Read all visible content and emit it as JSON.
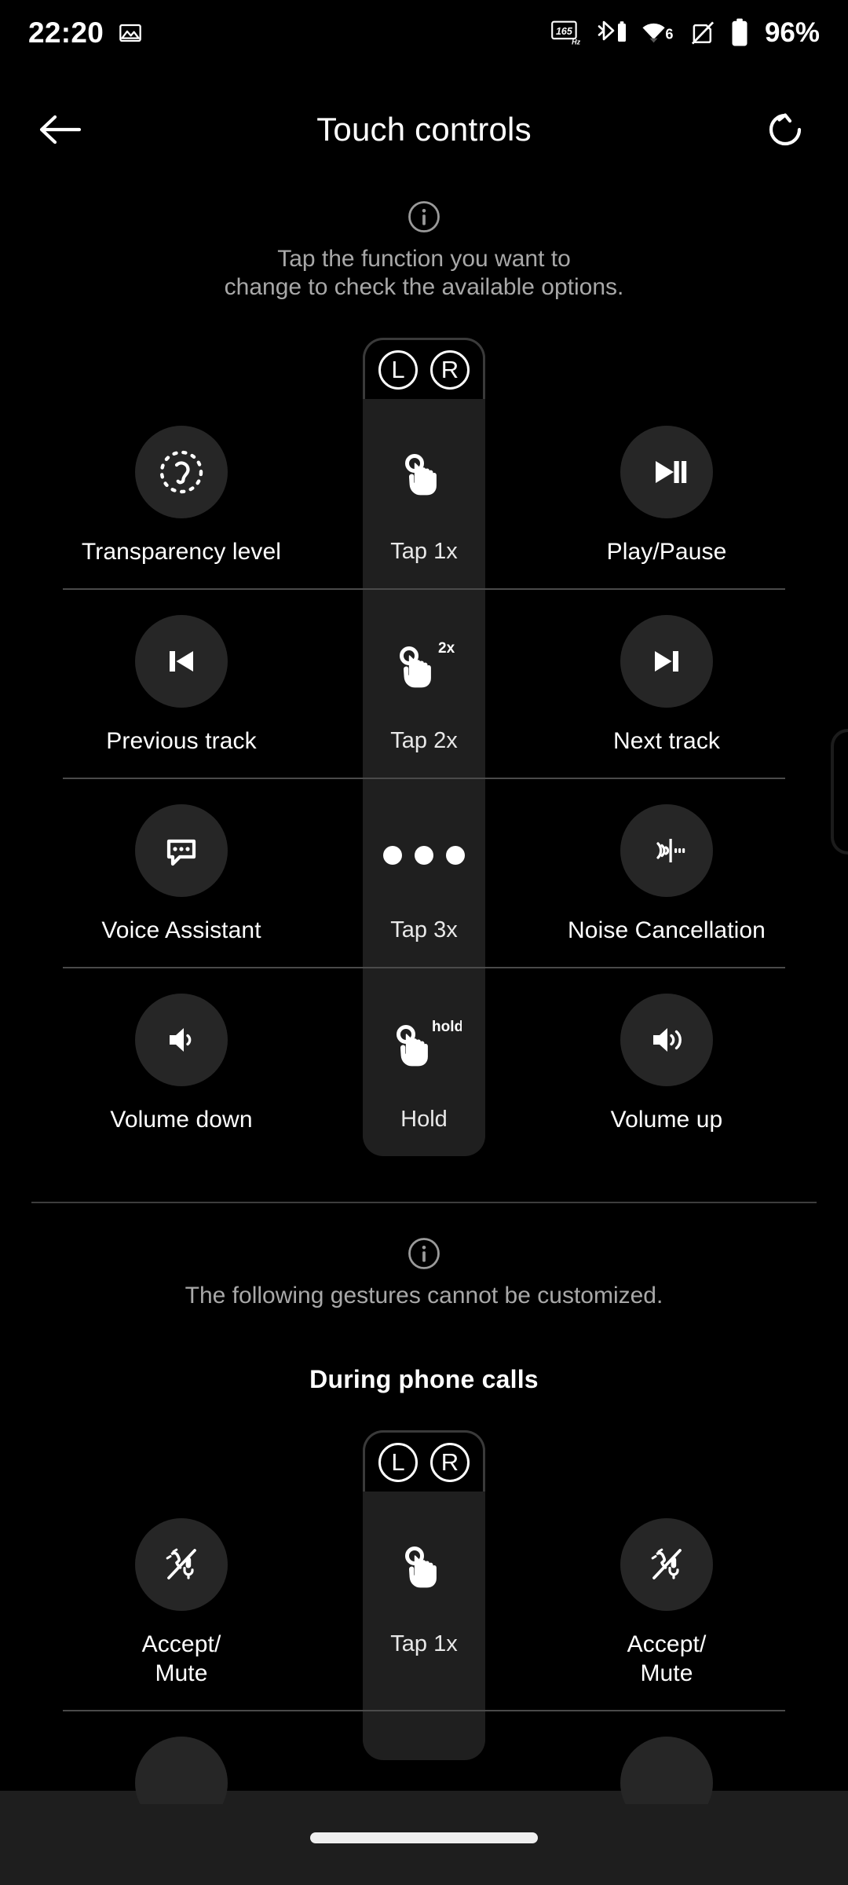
{
  "statusbar": {
    "time": "22:20",
    "left_icons": [
      {
        "name": "screenshot-image-icon"
      }
    ],
    "refresh_rate": "165",
    "refresh_rate_unit": "Hz",
    "wifi_generation": "6",
    "battery_percent": "96%",
    "right_icons": [
      {
        "name": "refresh-rate-icon"
      },
      {
        "name": "bluetooth-battery-icon"
      },
      {
        "name": "wifi-6-icon"
      },
      {
        "name": "nfc-off-icon"
      },
      {
        "name": "battery-icon"
      }
    ]
  },
  "appbar": {
    "back_label": "Back",
    "title": "Touch controls",
    "reset_label": "Reset"
  },
  "info_top": {
    "icon": "info-icon",
    "line1": "Tap the function you want to",
    "line2": "change to check the available options."
  },
  "earbud": {
    "left_badge": "L",
    "right_badge": "R"
  },
  "gesture_rows": [
    {
      "left": {
        "label": "Transparency level",
        "icon": "transparency-ear-icon"
      },
      "middle": {
        "label": "Tap 1x",
        "icon": "tap-hand-icon",
        "superscript": ""
      },
      "right": {
        "label": "Play/Pause",
        "icon": "play-pause-icon"
      }
    },
    {
      "left": {
        "label": "Previous track",
        "icon": "skip-previous-icon"
      },
      "middle": {
        "label": "Tap 2x",
        "icon": "tap-hand-icon",
        "superscript": "2x"
      },
      "right": {
        "label": "Next track",
        "icon": "skip-next-icon"
      }
    },
    {
      "left": {
        "label": "Voice Assistant",
        "icon": "speech-bubble-icon"
      },
      "middle": {
        "label": "Tap 3x",
        "icon": "three-dots-icon",
        "superscript": ""
      },
      "right": {
        "label": "Noise Cancellation",
        "icon": "noise-cancellation-icon"
      }
    },
    {
      "left": {
        "label": "Volume down",
        "icon": "volume-down-icon"
      },
      "middle": {
        "label": "Hold",
        "icon": "hold-hand-icon",
        "superscript": "hold"
      },
      "right": {
        "label": "Volume up",
        "icon": "volume-up-icon"
      }
    }
  ],
  "info_bottom": {
    "icon": "info-icon",
    "line1": "The following gestures cannot be customized."
  },
  "calls_section": {
    "title": "During phone calls",
    "left_badge": "L",
    "right_badge": "R",
    "rows": [
      {
        "left": {
          "label": "Accept/\nMute",
          "label_line1": "Accept/",
          "label_line2": "Mute",
          "icon": "accept-mute-call-icon"
        },
        "middle": {
          "label": "Tap 1x",
          "icon": "tap-hand-icon",
          "superscript": ""
        },
        "right": {
          "label": "Accept/\nMute",
          "label_line1": "Accept/",
          "label_line2": "Mute",
          "icon": "accept-mute-call-icon"
        }
      }
    ]
  },
  "navbar": {
    "pill_label": "Home gesture bar"
  },
  "colors": {
    "background": "#000000",
    "surface": "#1f1f1f",
    "icon_circle": "#262626",
    "text_primary": "#ffffff",
    "text_secondary": "#a8a8a8",
    "divider": "#4a4a4a",
    "navbar": "#1e1e1e"
  }
}
